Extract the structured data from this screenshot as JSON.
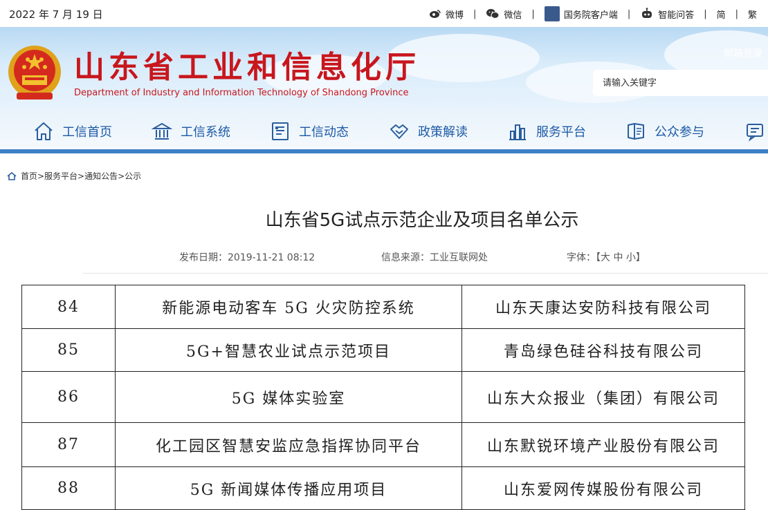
{
  "date": "2022 年 7 月 19 日",
  "top_links": [
    {
      "icon": "weibo-icon",
      "label": "微博"
    },
    {
      "icon": "wechat-icon",
      "label": "微信"
    },
    {
      "icon": "state-council-client-icon",
      "label": "国务院客户端"
    },
    {
      "icon": "robot-icon",
      "label": "智能问答"
    },
    {
      "icon": "",
      "label": "简"
    },
    {
      "icon": "",
      "label": "繁"
    }
  ],
  "site": {
    "title": "山东省工业和信息化厅",
    "subtitle": "Department of Industry and Information Technology of Shandong Province",
    "login": "邮箱登录",
    "search_placeholder": "请输入关键字"
  },
  "nav": [
    {
      "icon": "home-icon",
      "label": "工信首页"
    },
    {
      "icon": "institution-icon",
      "label": "工信系统"
    },
    {
      "icon": "news-icon",
      "label": "工信动态"
    },
    {
      "icon": "handshake-icon",
      "label": "政策解读"
    },
    {
      "icon": "buildings-icon",
      "label": "服务平台"
    },
    {
      "icon": "participation-icon",
      "label": "公众参与"
    },
    {
      "icon": "message-icon",
      "label": ""
    }
  ],
  "breadcrumb": "首页>服务平台>通知公告>公示",
  "article": {
    "title": "山东省5G试点示范企业及项目名单公示",
    "publish_date": "发布日期：2019-11-21 08:12",
    "source": "信息来源：工业互联网处",
    "font_size": "字体：【大 中 小】"
  },
  "table_rows": [
    {
      "no": "84",
      "project": "新能源电动客车 5G 火灾防控系统",
      "company": "山东天康达安防科技有限公司"
    },
    {
      "no": "85",
      "project": "5G+智慧农业试点示范项目",
      "company": "青岛绿色硅谷科技有限公司"
    },
    {
      "no": "86",
      "project": "5G 媒体实验室",
      "company": "山东大众报业（集团）有限公司"
    },
    {
      "no": "87",
      "project": "化工园区智慧安监应急指挥协同平台",
      "company": "山东默锐环境产业股份有限公司"
    },
    {
      "no": "88",
      "project": "5G 新闻媒体传播应用项目",
      "company": "山东爱网传媒股份有限公司"
    }
  ],
  "colors": {
    "brand_red": "#c8161d",
    "nav_blue": "#1d5aa6",
    "accent_bar": "#3d7fc6"
  }
}
